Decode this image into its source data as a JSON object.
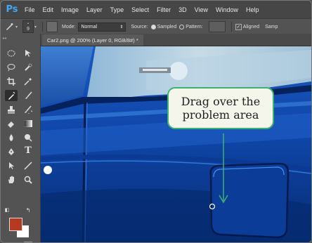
{
  "app": {
    "logo": "Ps"
  },
  "menu": [
    "File",
    "Edit",
    "Image",
    "Layer",
    "Type",
    "Select",
    "Filter",
    "3D",
    "View",
    "Window",
    "Help"
  ],
  "options_bar": {
    "brush_size": "9",
    "mode_label": "Mode:",
    "mode_value": "Normal",
    "source_label": "Source:",
    "source_sampled": "Sampled",
    "source_pattern": "Pattern:",
    "aligned_label": "Aligned",
    "sample_label": "Samp"
  },
  "document_tab": {
    "title": "Car2.png @ 200% (Layer 0, RGB/8#) *"
  },
  "tools": [
    "marquee-tool",
    "move-tool",
    "lasso-tool",
    "quick-selection-tool",
    "crop-tool",
    "eyedropper-tool",
    "spot-healing-brush-tool",
    "brush-tool",
    "clone-stamp-tool",
    "history-brush-tool",
    "eraser-tool",
    "gradient-tool",
    "blur-tool",
    "dodge-tool",
    "pen-tool",
    "type-tool",
    "path-selection-tool",
    "line-tool",
    "hand-tool",
    "zoom-tool"
  ],
  "colors": {
    "foreground": "#b53a1f",
    "background": "#ffffff",
    "accent_green": "#3cb36d"
  },
  "callout": {
    "line1": "Drag over the",
    "line2": "problem area"
  }
}
